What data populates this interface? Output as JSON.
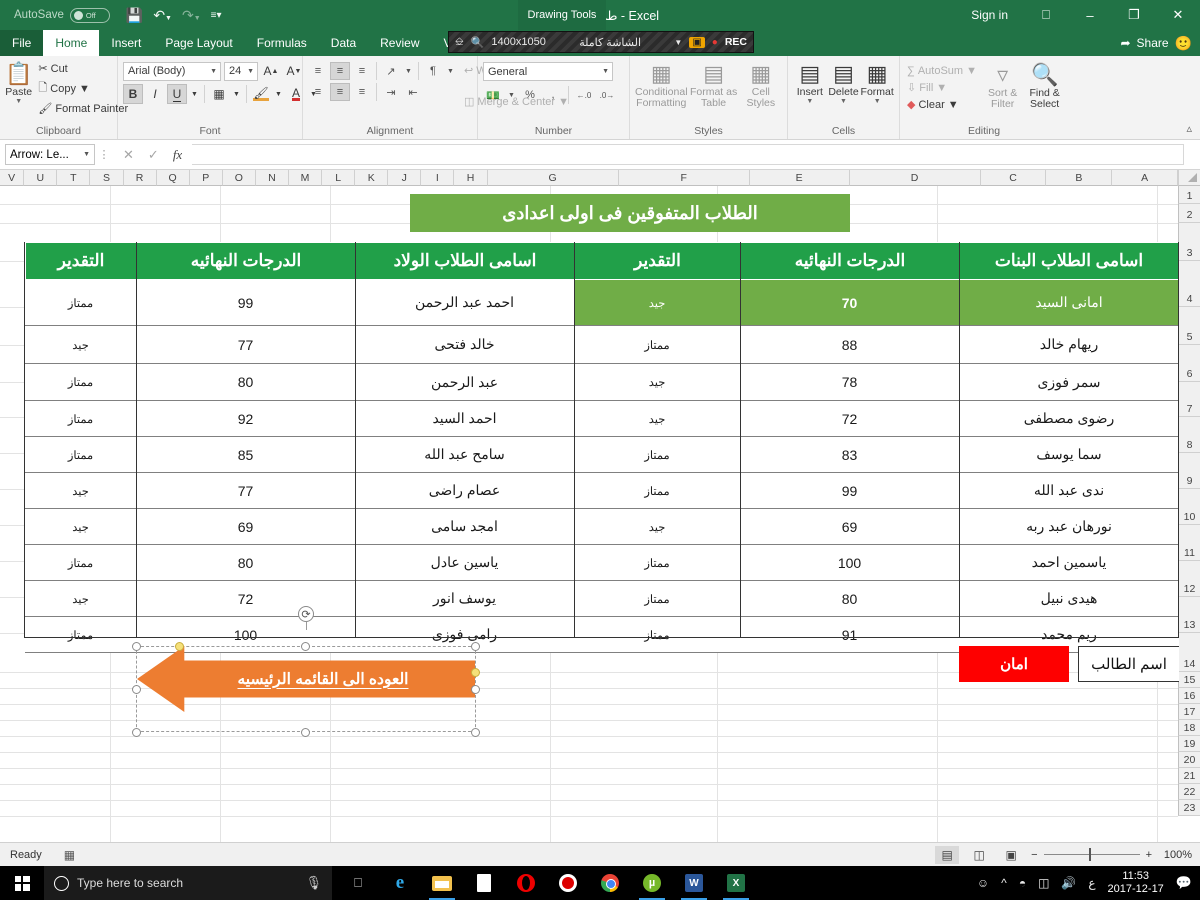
{
  "titlebar": {
    "autosave_label": "AutoSave",
    "autosave_state": "Off",
    "save_icon": "save-icon",
    "undo_icon": "undo-icon",
    "redo_icon": "redo-icon",
    "customize_icon": "customize-quick-access-icon",
    "document_title": "طلاب الاعداديه  -  Excel",
    "contextual_tab": "Drawing Tools",
    "signin": "Sign in",
    "ribbon_display_icon": "ribbon-display-options-icon",
    "minimize_icon": "minimize-icon",
    "restore_icon": "restore-icon",
    "close_icon": "close-icon"
  },
  "ribbon_tabs": {
    "items": [
      "File",
      "Home",
      "Insert",
      "Page Layout",
      "Formulas",
      "Data",
      "Review",
      "View"
    ],
    "active": "Home",
    "share_label": "Share"
  },
  "recorder_overlay": {
    "resolution": "1400x1050",
    "mode": "الشاشة كاملة",
    "rec_label": "REC",
    "camera_icon": "camera-icon",
    "zoom_icon": "magnifier-icon",
    "window_icon": "window-icon",
    "dropdown_icon": "chevron-down-icon"
  },
  "ribbon": {
    "clipboard": {
      "title": "Clipboard",
      "paste": "Paste",
      "cut": "Cut",
      "copy": "Copy",
      "format_painter": "Format Painter"
    },
    "font": {
      "title": "Font",
      "family": "Arial (Body)",
      "size": "24",
      "grow": "A",
      "shrink": "A",
      "bold": "B",
      "italic": "I",
      "underline": "U",
      "borders": "borders-icon",
      "fill_color": "A",
      "font_color": "A"
    },
    "alignment": {
      "title": "Alignment",
      "wrap_text": "Wrap Text",
      "merge_center": "Merge & Center",
      "orientation_icon": "text-orientation-icon",
      "rtl_icon": "right-to-left-icon"
    },
    "number": {
      "title": "Number",
      "format": "General",
      "percent": "%",
      "comma": ",",
      "accounting_icon": "accounting-format-icon",
      "increase_decimal": "increase-decimal-icon",
      "decrease_decimal": "decrease-decimal-icon"
    },
    "styles": {
      "title": "Styles",
      "conditional_formatting": "Conditional Formatting",
      "format_as_table": "Format as Table",
      "cell_styles": "Cell Styles"
    },
    "cells": {
      "title": "Cells",
      "insert": "Insert",
      "delete": "Delete",
      "format": "Format"
    },
    "editing": {
      "title": "Editing",
      "autosum": "AutoSum",
      "fill": "Fill",
      "clear": "Clear",
      "sort_filter": "Sort & Filter",
      "find_select": "Find & Select",
      "collapse_icon": "collapse-ribbon-icon"
    }
  },
  "formula_bar": {
    "name_box": "Arrow: Le...",
    "cancel_icon": "cancel-icon",
    "enter_icon": "confirm-icon",
    "fx_icon": "fx",
    "formula_value": ""
  },
  "grid": {
    "column_headers": [
      "A",
      "B",
      "C",
      "D",
      "E",
      "F",
      "G",
      "H",
      "I",
      "J",
      "K",
      "L",
      "M",
      "N",
      "O",
      "P",
      "Q",
      "R",
      "S",
      "T",
      "U",
      "V"
    ],
    "row_headers": [
      "1",
      "2",
      "3",
      "4",
      "5",
      "6",
      "7",
      "8",
      "9",
      "10",
      "11",
      "12",
      "13",
      "14",
      "15",
      "16",
      "17",
      "18",
      "19",
      "20",
      "21",
      "22",
      "23"
    ],
    "sheet_title": "الطلاب المتفوقين فى اولى اعدادى",
    "headers_girls": {
      "name": "اسامى الطلاب البنات",
      "score": "الدرجات النهائيه",
      "grade": "التقدير"
    },
    "headers_boys": {
      "name": "اسامى الطلاب الولاد",
      "score": "الدرجات النهائيه",
      "grade": "التقدير"
    },
    "girls": [
      {
        "name": "امانى السيد",
        "score": "70",
        "grade": "جيد",
        "selected": true
      },
      {
        "name": "ريهام خالد",
        "score": "88",
        "grade": "ممتاز",
        "selected": false
      },
      {
        "name": "سمر فوزى",
        "score": "78",
        "grade": "جيد",
        "selected": false
      },
      {
        "name": "رضوى مصطفى",
        "score": "72",
        "grade": "جيد",
        "selected": false
      },
      {
        "name": "سما يوسف",
        "score": "83",
        "grade": "ممتاز",
        "selected": false
      },
      {
        "name": "ندى عبد الله",
        "score": "99",
        "grade": "ممتاز",
        "selected": false
      },
      {
        "name": "نورهان عبد ربه",
        "score": "69",
        "grade": "جيد",
        "selected": false
      },
      {
        "name": "ياسمين احمد",
        "score": "100",
        "grade": "ممتاز",
        "selected": false
      },
      {
        "name": "هيدى نبيل",
        "score": "80",
        "grade": "ممتاز",
        "selected": false
      },
      {
        "name": "ريم محمد",
        "score": "91",
        "grade": "ممتاز",
        "selected": false
      }
    ],
    "boys": [
      {
        "name": "احمد عبد الرحمن",
        "score": "99",
        "grade": "ممتاز"
      },
      {
        "name": "خالد فتحى",
        "score": "77",
        "grade": "جيد"
      },
      {
        "name": "عبد الرحمن",
        "score": "80",
        "grade": "ممتاز"
      },
      {
        "name": "احمد السيد",
        "score": "92",
        "grade": "ممتاز"
      },
      {
        "name": "سامح عبد الله",
        "score": "85",
        "grade": "ممتاز"
      },
      {
        "name": "عصام راضى",
        "score": "77",
        "grade": "جيد"
      },
      {
        "name": "امجد سامى",
        "score": "69",
        "grade": "جيد"
      },
      {
        "name": "ياسين عادل",
        "score": "80",
        "grade": "ممتاز"
      },
      {
        "name": "يوسف انور",
        "score": "72",
        "grade": "جيد"
      },
      {
        "name": "رامى فوزى",
        "score": "100",
        "grade": "ممتاز"
      }
    ],
    "student_name_label": "اسم الطالب",
    "red_cell_value": "امان",
    "arrow_shape_text": "العوده الى القائمه الرئيسيه",
    "colors": {
      "banner_green": "#70ad47",
      "header_green": "#21a049",
      "selected_green": "#70ad47",
      "red_cell": "#fe0000",
      "arrow_orange": "#ed7d31"
    }
  },
  "statusbar": {
    "state": "Ready",
    "macro_icon": "record-macro-icon",
    "normal_view_icon": "normal-view-icon",
    "page_layout_icon": "page-layout-view-icon",
    "page_break_icon": "page-break-preview-icon",
    "zoom_out": "−",
    "zoom_in": "+",
    "zoom_level": "100%"
  },
  "taskbar": {
    "start_icon": "windows-start-icon",
    "search_placeholder": "Type here to search",
    "mic_icon": "microphone-icon",
    "task_view_icon": "task-view-icon",
    "apps": [
      "edge-icon",
      "file-explorer-icon",
      "document-icon",
      "opera-icon",
      "screen-recorder-icon",
      "chrome-icon",
      "utorrent-icon",
      "word-icon",
      "excel-icon"
    ],
    "tray": {
      "people_icon": "people-icon",
      "show_hidden_icon": "show-hidden-icons-icon",
      "network_icon": "network-icon",
      "battery_icon": "battery-icon",
      "volume_icon": "volume-icon",
      "language": "ع",
      "time": "11:53",
      "date": "2017-12-17",
      "action_center_icon": "action-center-icon"
    }
  }
}
